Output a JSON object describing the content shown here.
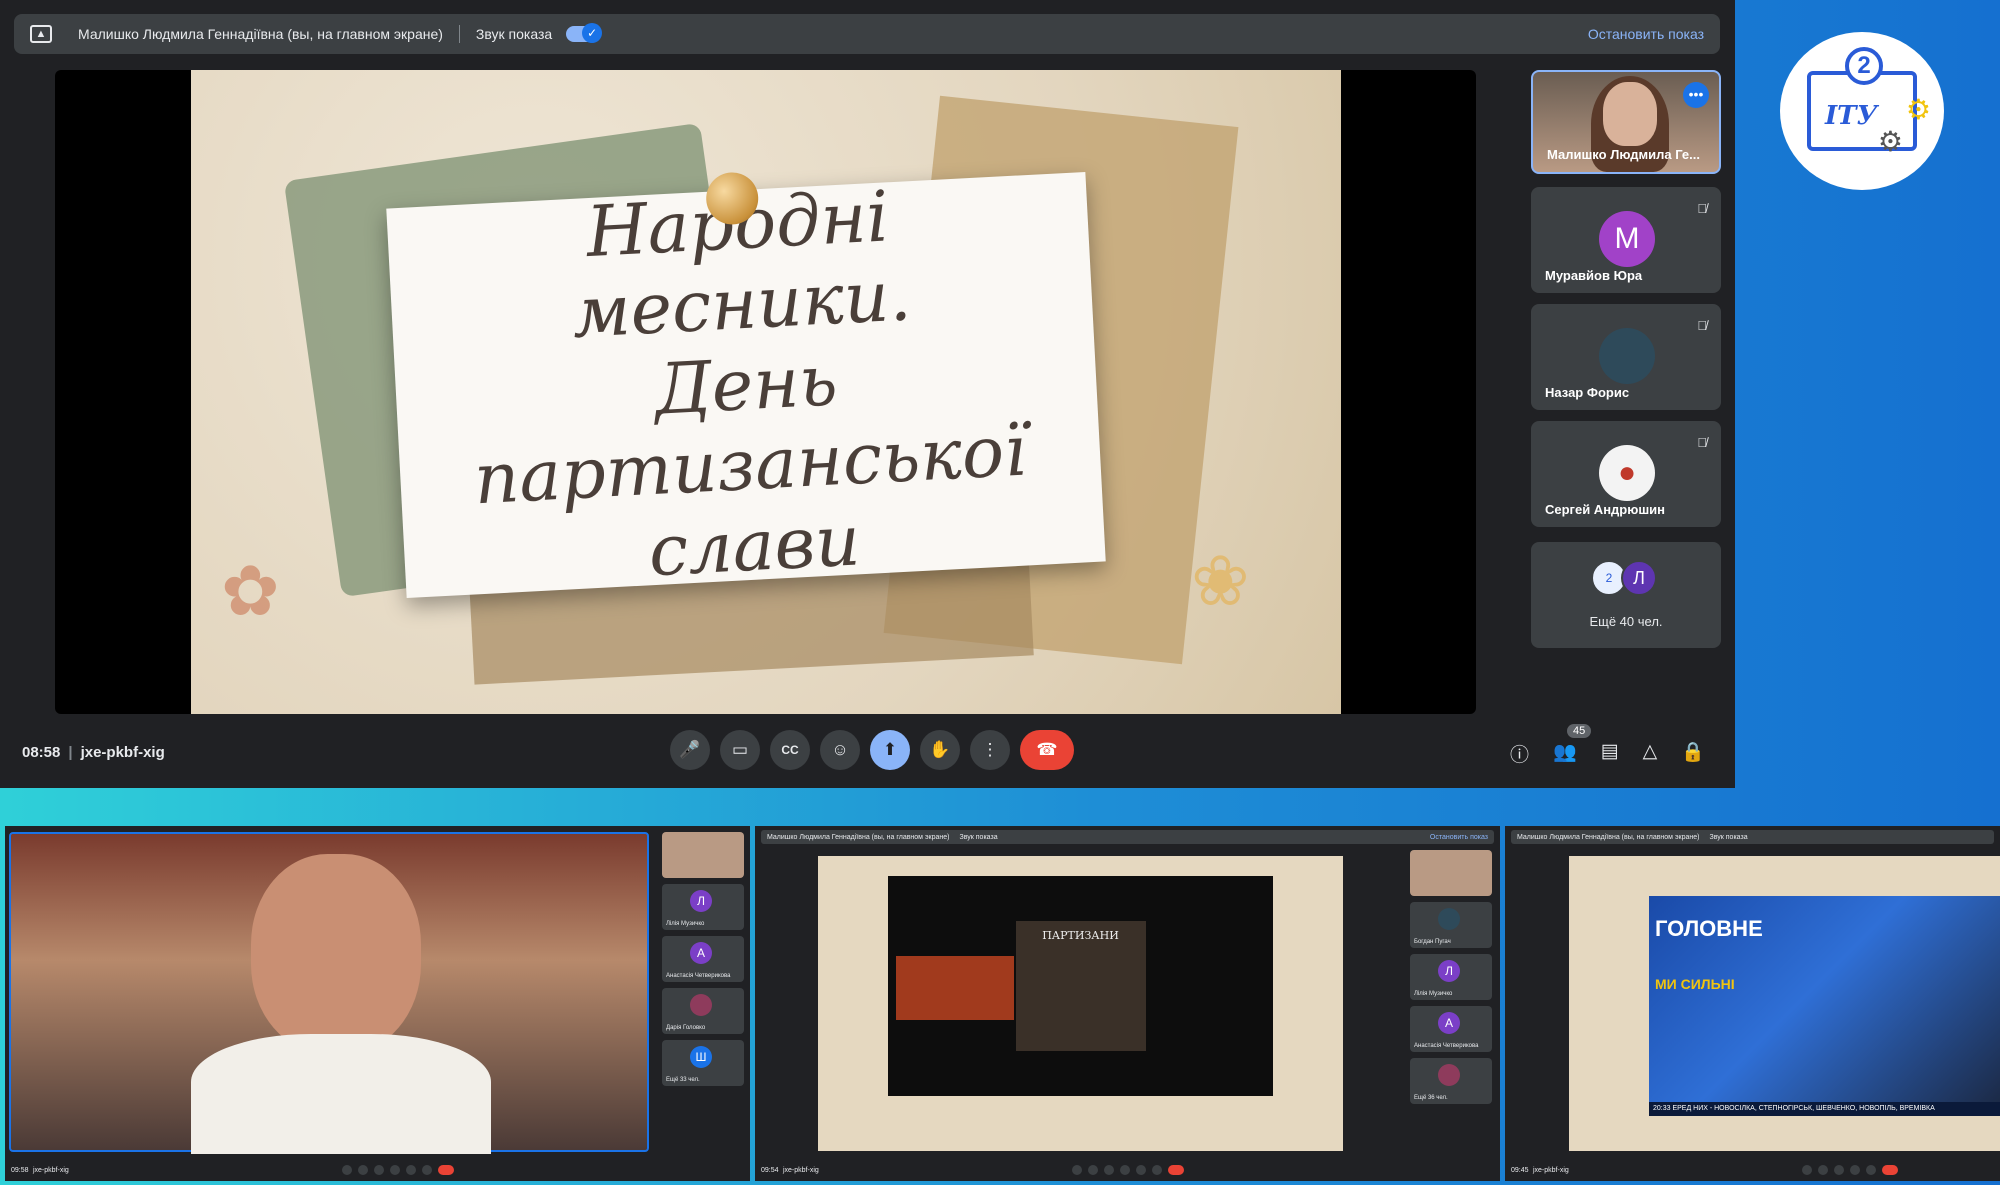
{
  "share_bar": {
    "presenter": "Малишко Людмила Геннадіївна (вы, на главном экране)",
    "sound_label": "Звук показа",
    "stop_label": "Остановить показ"
  },
  "slide": {
    "line1": "Народні месники.",
    "line2": "День партизанської",
    "line3": "слави"
  },
  "participants": {
    "self_name": "Малишко Людмила Ге...",
    "p1_initial": "М",
    "p1_name": "Муравйов Юра",
    "p2_name": "Назар Форис",
    "p3_name": "Сергей Андрюшин",
    "more_initial": "Л",
    "more_label": "Ещё 40 чел."
  },
  "controls": {
    "time": "08:58",
    "meeting_code": "jxe-pkbf-xig",
    "people_count": "45"
  },
  "logo": {
    "number": "2",
    "text": "ІТУ"
  },
  "thumbs": {
    "t1_time": "09:58",
    "t1_code": "jxe-pkbf-xig",
    "t1_side": [
      {
        "initial": "Л",
        "name": "Лілія Музичко"
      },
      {
        "initial": "А",
        "name": "Анастасія Четверикова"
      },
      {
        "initial": "",
        "name": "Дарія Головко"
      },
      {
        "initial": "Ш",
        "name": "Ещё 33 чел."
      }
    ],
    "t2_time": "09:54",
    "t2_code": "jxe-pkbf-xig",
    "t2_presenter": "Малишко Людмила Геннадіївна (вы, на главном экране)",
    "t2_sound": "Звук показа",
    "t2_stop": "Остановить показ",
    "t2_caption": "ПАРТИЗАНИ",
    "t2_side": [
      {
        "initial": "",
        "name": "Богдан Пугач"
      },
      {
        "initial": "Л",
        "name": "Лілія Музичко"
      },
      {
        "initial": "А",
        "name": "Анастасія Четверикова"
      },
      {
        "initial": "",
        "name": "Ещё 36 чел."
      }
    ],
    "t3_time": "09:45",
    "t3_code": "jxe-pkbf-xig",
    "t3_presenter": "Малишко Людмила Геннадіївна (вы, на главном экране)",
    "t3_sound": "Звук показа",
    "t3_tv_title": "ГОЛОВНЕ",
    "t3_tv_sub": "МИ СИЛЬНІ",
    "t3_ticker": "20:33 ЕРЕД НИХ - НОВОСІЛКА, СТЕПНОГІРСЬК, ШЕВЧЕНКО, НОВОПІЛЬ, ВРЕМІВКА"
  }
}
